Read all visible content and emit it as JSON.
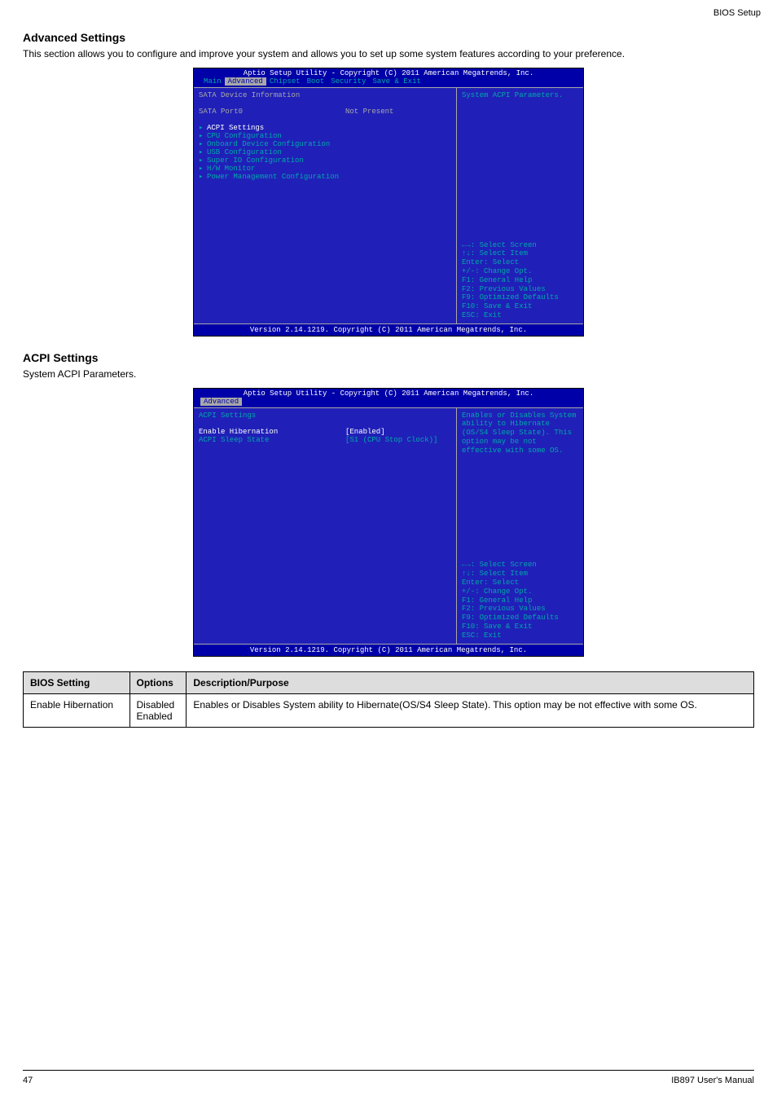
{
  "page": {
    "top_right": "BIOS Setup",
    "footer_left": "47",
    "footer_right": "IB897 User's Manual"
  },
  "sec1": {
    "title": "Advanced Settings",
    "text": "This section allows you to configure and improve your system and allows you to set up some system features according to your preference."
  },
  "bios1": {
    "header": "Aptio Setup Utility - Copyright (C) 2011 American Megatrends, Inc.",
    "tabs": [
      "Main",
      "Advanced",
      "Chipset",
      "Boot",
      "Security",
      "Save & Exit"
    ],
    "active_tab": 1,
    "left_info_label": "SATA Device Information",
    "left_port_label": "SATA Port0",
    "left_port_value": "Not Present",
    "submenus": [
      "ACPI Settings",
      "CPU Configuration",
      "Onboard Device Configuration",
      "USB Configuration",
      "Super IO Configuration",
      "H/W Monitor",
      "Power Management Configuration"
    ],
    "selected_submenu_index": 0,
    "right_help": "System ACPI Parameters.",
    "keys": [
      "←→: Select Screen",
      "↑↓: Select Item",
      "Enter: Select",
      "+/-: Change Opt.",
      "F1: General Help",
      "F2: Previous Values",
      "F9: Optimized Defaults",
      "F10: Save & Exit",
      "ESC: Exit"
    ],
    "footer": "Version 2.14.1219. Copyright (C) 2011 American Megatrends, Inc."
  },
  "sec2": {
    "title": "ACPI Settings",
    "text": "System ACPI Parameters."
  },
  "bios2": {
    "header": "Aptio Setup Utility - Copyright (C) 2011 American Megatrends, Inc.",
    "tabs": [
      "Advanced"
    ],
    "active_tab": 0,
    "heading": "ACPI Settings",
    "items": [
      {
        "label": "Enable Hibernation",
        "value": "[Enabled]",
        "selected": true
      },
      {
        "label": "ACPI Sleep State",
        "value": "[S1 (CPU Stop Clock)]",
        "selected": false
      }
    ],
    "right_help": "Enables or Disables System ability to Hibernate (OS/S4 Sleep State). This option may be not effective with some OS.",
    "keys": [
      "←→: Select Screen",
      "↑↓: Select Item",
      "Enter: Select",
      "+/-: Change Opt.",
      "F1: General Help",
      "F2: Previous Values",
      "F9: Optimized Defaults",
      "F10: Save & Exit",
      "ESC: Exit"
    ],
    "footer": "Version 2.14.1219. Copyright (C) 2011 American Megatrends, Inc."
  },
  "table": {
    "headers": [
      "BIOS Setting",
      "Options",
      "Description/Purpose"
    ],
    "rows": [
      [
        "Enable Hibernation",
        "Disabled\nEnabled",
        "Enables or Disables System ability to Hibernate(OS/S4 Sleep State). This option may be not effective with some OS."
      ]
    ]
  }
}
